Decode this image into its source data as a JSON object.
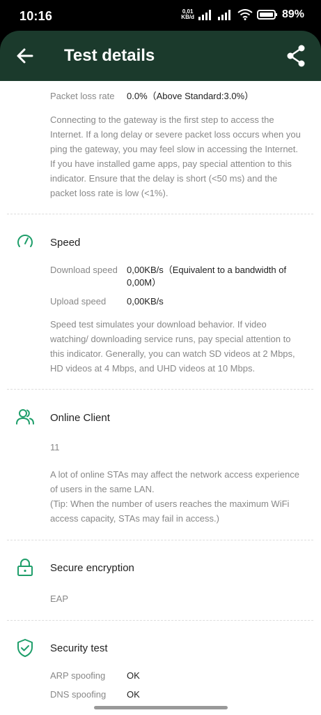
{
  "status": {
    "time": "10:16",
    "rate_value": "0,01",
    "rate_unit": "KB/d",
    "battery": "89%"
  },
  "appbar": {
    "title": "Test details"
  },
  "gateway": {
    "loss_label": "Packet loss rate",
    "loss_value": "0.0%（Above Standard:3.0%）",
    "description": "Connecting to the gateway is the first step to access the Internet. If a long delay or severe packet loss occurs when you ping the gateway, you may feel slow in accessing the Internet. If you have installed game apps, pay special attention to this indicator. Ensure that the delay is short (<50 ms) and the packet loss rate is low (<1%)."
  },
  "speed": {
    "title": "Speed",
    "download_label": "Download speed",
    "download_value": "0,00KB/s（Equivalent to a bandwidth of 0,00M）",
    "upload_label": "Upload speed",
    "upload_value": "0,00KB/s",
    "description": "Speed test simulates your download behavior. If video watching/ downloading service runs, pay special attention to this indicator. Generally, you can watch SD videos at 2 Mbps, HD videos at 4 Mbps, and UHD videos at 10 Mbps."
  },
  "online_client": {
    "title": "Online Client",
    "count": "11",
    "description": "A lot of online STAs may affect the network access experience of users in the same LAN.",
    "tip": "(Tip: When the number of users reaches the maximum WiFi access capacity, STAs may fail in access.)"
  },
  "encryption": {
    "title": "Secure encryption",
    "value": "EAP"
  },
  "security": {
    "title": "Security test",
    "arp_label": "ARP spoofing",
    "arp_value": "OK",
    "dns_label": "DNS spoofing",
    "dns_value": "OK"
  },
  "colors": {
    "appbar": "#1b3a2c",
    "accent": "#1e9e6a"
  }
}
